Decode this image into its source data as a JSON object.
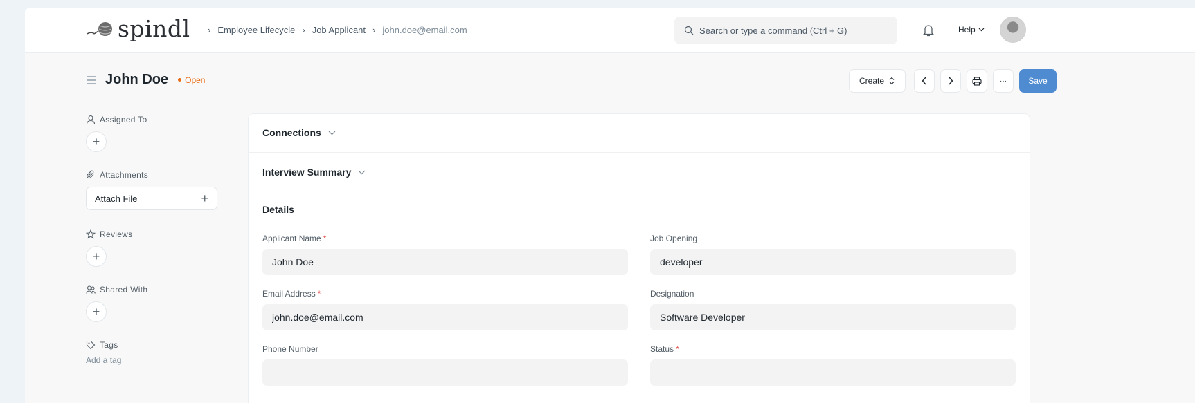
{
  "brand": {
    "name": "spindl"
  },
  "breadcrumbs": [
    "Employee Lifecycle",
    "Job Applicant",
    "john.doe@email.com"
  ],
  "search": {
    "placeholder": "Search or type a command (Ctrl + G)"
  },
  "navbar": {
    "help_label": "Help"
  },
  "page": {
    "title": "John Doe",
    "status": "Open",
    "status_color": "#e86c13"
  },
  "actions": {
    "create_label": "Create",
    "more_label": "···",
    "save_label": "Save",
    "save_color": "#4e8bd1"
  },
  "sidebar": {
    "assigned_to": "Assigned To",
    "attachments": "Attachments",
    "attach_file": "Attach File",
    "reviews": "Reviews",
    "shared_with": "Shared With",
    "tags": "Tags",
    "add_tag": "Add a tag"
  },
  "sections": {
    "connections": "Connections",
    "interview_summary": "Interview Summary",
    "details": "Details"
  },
  "fields": {
    "applicant_name": {
      "label": "Applicant Name",
      "value": "John Doe"
    },
    "job_opening": {
      "label": "Job Opening",
      "value": "developer"
    },
    "email_address": {
      "label": "Email Address",
      "value": "john.doe@email.com"
    },
    "designation": {
      "label": "Designation",
      "value": "Software Developer"
    },
    "phone_number": {
      "label": "Phone Number",
      "value": ""
    },
    "status": {
      "label": "Status",
      "value": ""
    }
  }
}
